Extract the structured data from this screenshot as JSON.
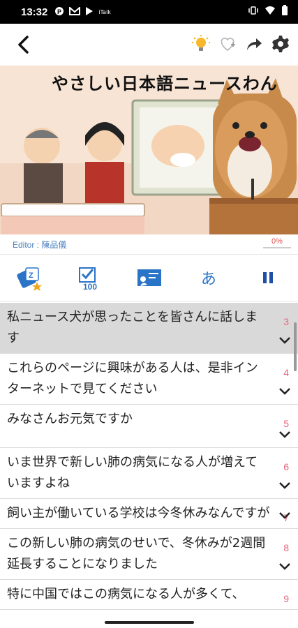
{
  "status": {
    "time": "13:32",
    "extra": "iTalk"
  },
  "banner": {
    "title": "やさしい日本語ニュースわん"
  },
  "editor": {
    "label": "Editor : 陳品儀",
    "progress": "0%"
  },
  "action_bar": {
    "hiragana": "あ"
  },
  "sentences": [
    {
      "text": "私ニュース犬が思ったことを皆さんに話します",
      "num": "3"
    },
    {
      "text": "これらのページに興味がある人は、是非インターネットで見てください",
      "num": "4"
    },
    {
      "text": "みなさんお元気ですか",
      "num": "5"
    },
    {
      "text": "いま世界で新しい肺の病気になる人が増えていますよね",
      "num": "6"
    },
    {
      "text": "飼い主が働いている学校は今冬休みなんですが",
      "num": "7"
    },
    {
      "text": "この新しい肺の病気のせいで、冬休みが2週間延長することになりました",
      "num": "8"
    },
    {
      "text": "特に中国ではこの病気になる人が多くて、",
      "num": "9"
    }
  ],
  "colors": {
    "accent": "#2a74c8",
    "number": "#e8647a",
    "active_row": "#d9d9d9"
  }
}
